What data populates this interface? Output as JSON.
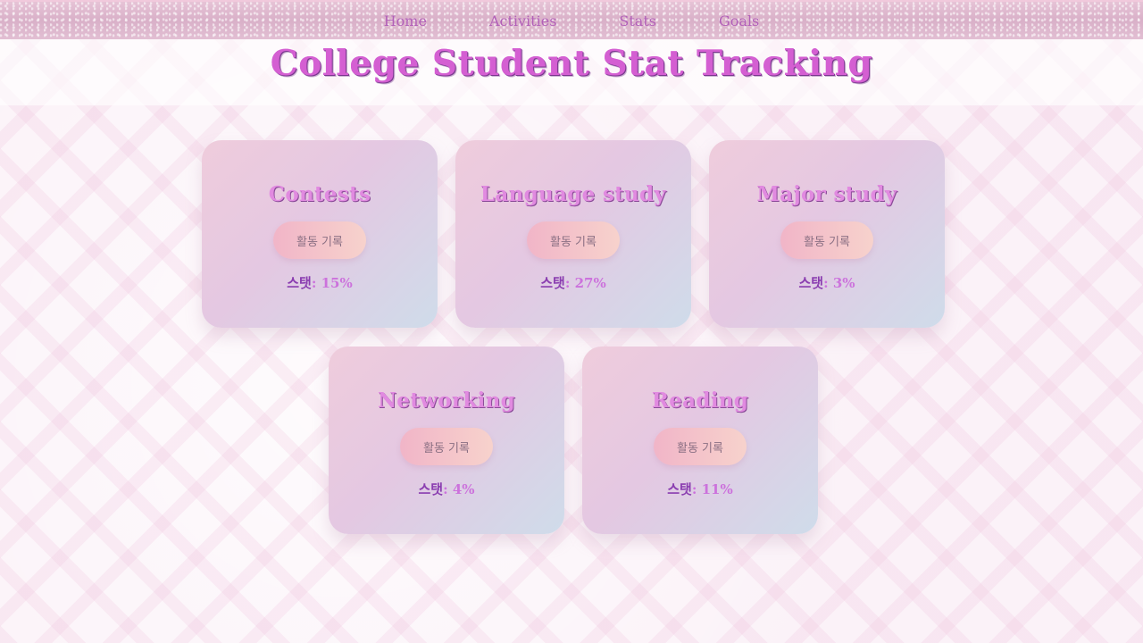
{
  "nav": {
    "items": [
      {
        "label": "Home"
      },
      {
        "label": "Activities"
      },
      {
        "label": "Stats"
      },
      {
        "label": "Goals"
      }
    ]
  },
  "header": {
    "title": "College Student Stat Tracking"
  },
  "cards": [
    {
      "title": "Contests",
      "button_label": "활동 기록",
      "stat_label": "스탯",
      "stat_value": ": 15%"
    },
    {
      "title": "Language study",
      "button_label": "활동 기록",
      "stat_label": "스탯",
      "stat_value": ": 27%"
    },
    {
      "title": "Major study",
      "button_label": "활동 기록",
      "stat_label": "스탯",
      "stat_value": ": 3%"
    },
    {
      "title": "Networking",
      "button_label": "활동 기록",
      "stat_label": "스탯",
      "stat_value": ": 4%"
    },
    {
      "title": "Reading",
      "button_label": "활동 기록",
      "stat_label": "스탯",
      "stat_value": ": 11%"
    }
  ],
  "colors": {
    "accent": "#d45fd2",
    "nav_text": "#b25fb8",
    "stat_label": "#8a3db0",
    "button_text": "#8a6f83"
  }
}
